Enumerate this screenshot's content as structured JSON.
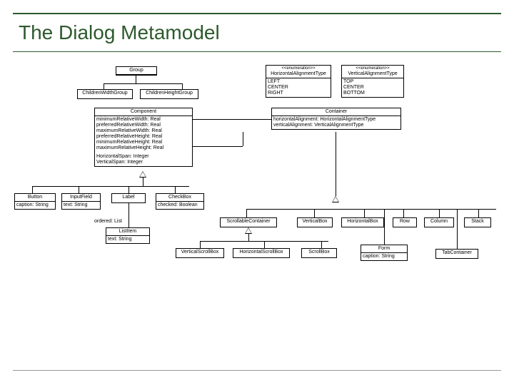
{
  "title": "The Dialog Metamodel",
  "classes": {
    "Group": {
      "name": "Group"
    },
    "ChildrenWidthGroup": {
      "name": "ChildrenWidthGroup"
    },
    "ChildrenHeightGroup": {
      "name": "ChildrenHeightGroup"
    },
    "Component": {
      "name": "Component",
      "attrs": [
        "minimumRelativeWidth: Real",
        "preferredRelativeWidth: Real",
        "maximumRelativeWidth: Real",
        "preferredRelativeHeight: Real",
        "minimumRelativeHeight: Real",
        "maximumRelativeHeight: Real",
        "",
        "HorizontalSpan: Integer",
        "VerticalSpan: Integer"
      ]
    },
    "HorizontalAlignmentType": {
      "stereo": "<<enumeration>>",
      "name": "HorizontalAlignmentType",
      "literals": [
        "LEFT",
        "CENTER",
        "RIGHT"
      ]
    },
    "VerticalAlignmentType": {
      "stereo": "<<enumeration>>",
      "name": "VerticalAlignmentType",
      "literals": [
        "TOP",
        "CENTER",
        "BOTTOM"
      ]
    },
    "Container": {
      "name": "Container",
      "attrs": [
        "horizontalAlignment: HorizontalAlignmentType",
        "verticalAlignment: VerticalAlignmentType"
      ]
    },
    "Button": {
      "name": "Button",
      "attrs": [
        "caption: String"
      ]
    },
    "InputField": {
      "name": "InputField",
      "attrs": [
        "text: String"
      ]
    },
    "Label": {
      "name": "Label"
    },
    "CheckBox": {
      "name": "CheckBox",
      "attrs": [
        "checked: Boolean"
      ]
    },
    "ListItem": {
      "name": "ListItem",
      "attrs": [
        "text: String"
      ]
    },
    "ScrollableContainer": {
      "name": "ScrollableContainer"
    },
    "VerticalBox": {
      "name": "VerticalBox"
    },
    "HorizontalBox": {
      "name": "HorizontalBox"
    },
    "Row": {
      "name": "Row"
    },
    "Column": {
      "name": "Column"
    },
    "Stack": {
      "name": "Stack"
    },
    "VerticalScrollBox": {
      "name": "VerticalScrollBox"
    },
    "HorizontalScrollBox": {
      "name": "HorizontalScrollBox"
    },
    "ScrollBox": {
      "name": "ScrollBox"
    },
    "Form": {
      "name": "Form",
      "attrs": [
        "caption: String"
      ]
    },
    "TabContainer": {
      "name": "TabContainer"
    },
    "orderedLabel": "ordered: List"
  }
}
